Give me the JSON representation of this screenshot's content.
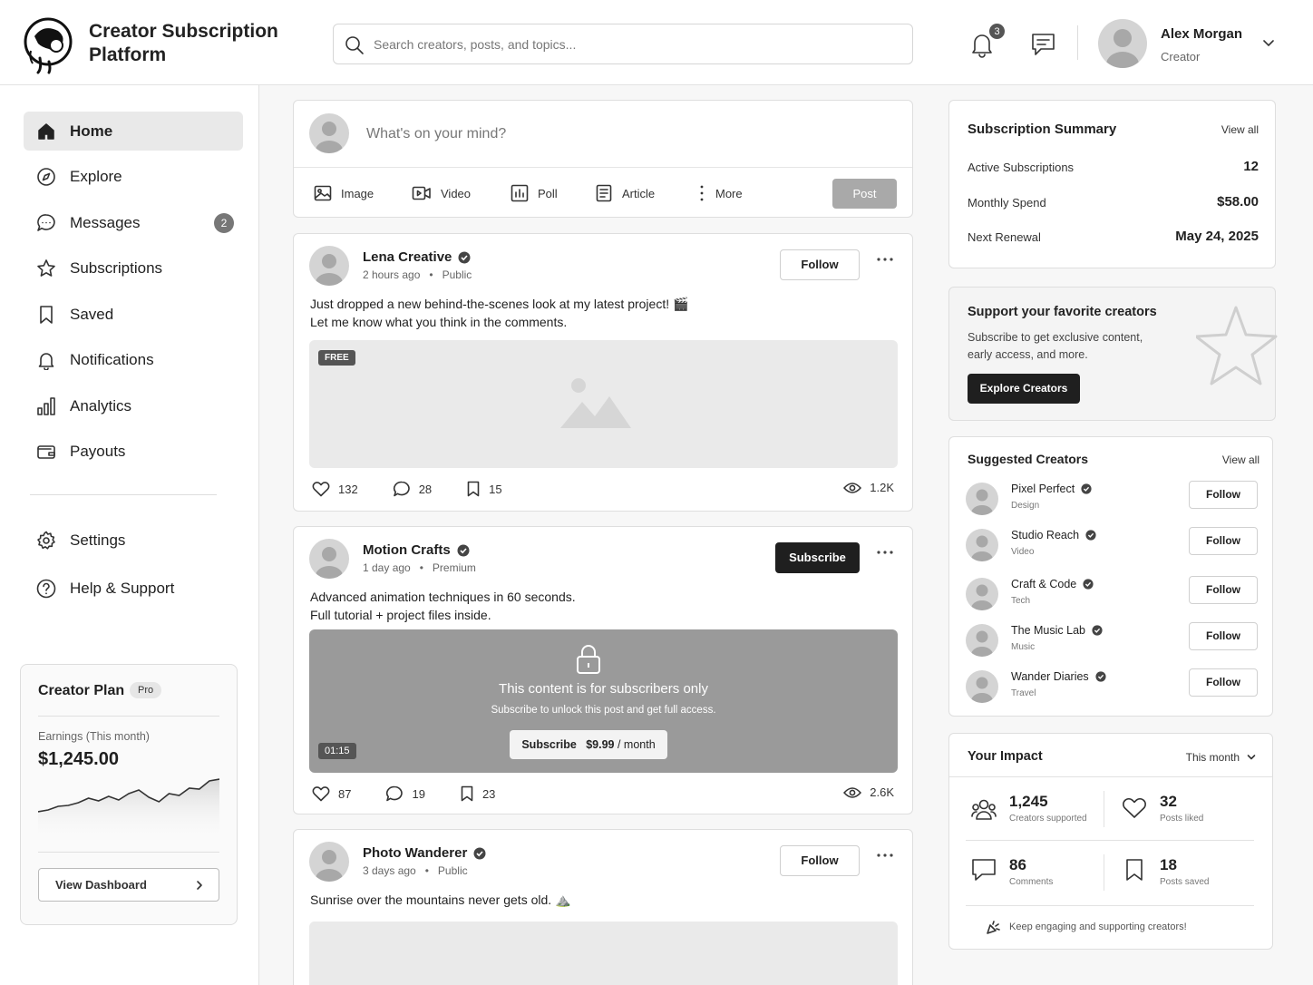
{
  "app": {
    "title_line1": "Creator Subscription",
    "title_line2": "Platform"
  },
  "search": {
    "placeholder": "Search creators, posts, and topics..."
  },
  "header": {
    "notification_count": "3",
    "user_name": "Alex Morgan",
    "user_role": "Creator"
  },
  "sidebar": {
    "items": [
      {
        "label": "Home",
        "icon": "home-icon",
        "active": true
      },
      {
        "label": "Explore",
        "icon": "compass-icon"
      },
      {
        "label": "Messages",
        "icon": "message-icon",
        "count": "2"
      },
      {
        "label": "Subscriptions",
        "icon": "star-icon"
      },
      {
        "label": "Saved",
        "icon": "bookmark-icon"
      },
      {
        "label": "Notifications",
        "icon": "bell-icon"
      },
      {
        "label": "Analytics",
        "icon": "bar-chart-icon"
      },
      {
        "label": "Payouts",
        "icon": "wallet-icon"
      }
    ],
    "settings": "Settings",
    "help": "Help & Support",
    "plan": {
      "title": "Creator Plan",
      "badge": "Pro",
      "earnings_label": "Earnings (This month)",
      "earnings_value": "$1,245.00",
      "button": "View Dashboard",
      "sparkline": [
        40,
        38,
        34,
        33,
        30,
        25,
        28,
        23,
        27,
        20,
        16,
        24,
        29,
        20,
        22,
        14,
        15,
        6,
        4
      ]
    }
  },
  "composer": {
    "placeholder": "What's on your mind?",
    "tools": [
      "Image",
      "Video",
      "Poll",
      "Article",
      "More"
    ],
    "post_button": "Post"
  },
  "posts": [
    {
      "author": "Lena Creative",
      "time": "2 hours ago",
      "visibility": "Public",
      "action": "Follow",
      "text_line1": "Just dropped a new behind-the-scenes look at my latest project! 🎬",
      "text_line2": "Let me know what you think in the comments.",
      "badge": "FREE",
      "likes": "132",
      "comments": "28",
      "saves": "15",
      "views": "1.2K"
    },
    {
      "author": "Motion Crafts",
      "time": "1 day ago",
      "visibility": "Premium",
      "action": "Subscribe",
      "text_line1": "Advanced animation techniques in 60 seconds.",
      "text_line2": "Full tutorial + project files inside.",
      "lock_title": "This content is for subscribers only",
      "lock_sub": "Subscribe to unlock this post and get full access.",
      "unlock_label": "Subscribe",
      "unlock_price": "$9.99",
      "unlock_period": "/ month",
      "duration": "01:15",
      "likes": "87",
      "comments": "19",
      "saves": "23",
      "views": "2.6K"
    },
    {
      "author": "Photo Wanderer",
      "time": "3 days ago",
      "visibility": "Public",
      "action": "Follow",
      "text_line1": "Sunrise over the mountains never gets old. ⛰️"
    }
  ],
  "summary": {
    "title": "Subscription Summary",
    "view_all": "View all",
    "rows": [
      {
        "label": "Active Subscriptions",
        "value": "12"
      },
      {
        "label": "Monthly Spend",
        "value": "$58.00"
      },
      {
        "label": "Next Renewal",
        "value": "May 24, 2025"
      }
    ]
  },
  "promo": {
    "title": "Support your favorite creators",
    "line1": "Subscribe to get exclusive content,",
    "line2": "early access, and more.",
    "button": "Explore Creators"
  },
  "suggested": {
    "title": "Suggested Creators",
    "view_all": "View all",
    "follow_label": "Follow",
    "creators": [
      {
        "name": "Pixel Perfect",
        "category": "Design"
      },
      {
        "name": "Studio Reach",
        "category": "Video"
      },
      {
        "name": "Craft & Code",
        "category": "Tech"
      },
      {
        "name": "The Music Lab",
        "category": "Music"
      },
      {
        "name": "Wander Diaries",
        "category": "Travel"
      }
    ]
  },
  "impact": {
    "title": "Your Impact",
    "period": "This month",
    "stats": [
      {
        "value": "1,245",
        "label": "Creators supported",
        "icon": "users-icon"
      },
      {
        "value": "32",
        "label": "Posts liked",
        "icon": "heart-icon"
      },
      {
        "value": "86",
        "label": "Comments",
        "icon": "comment-icon"
      },
      {
        "value": "18",
        "label": "Posts saved",
        "icon": "bookmark-icon"
      }
    ],
    "footer": "Keep engaging and supporting creators!"
  }
}
